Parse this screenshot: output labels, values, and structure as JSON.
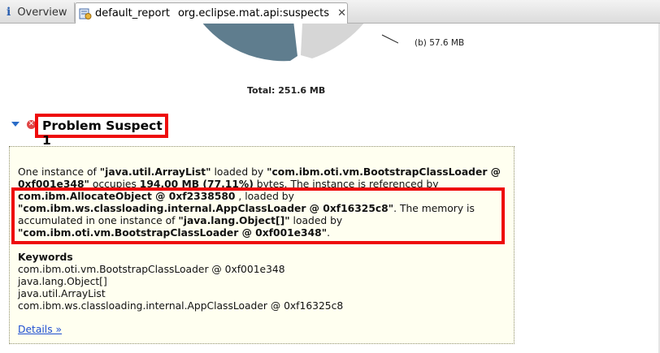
{
  "tabs": {
    "overview_label": "Overview",
    "active_name": "default_report",
    "active_query": "org.eclipse.mat.api:suspects"
  },
  "chart_data": {
    "type": "pie",
    "total_label": "Total: 251.6 MB",
    "slices": [
      {
        "label": "",
        "value": 194.0,
        "color": "#5f7d8e"
      },
      {
        "label": "(b)  57.6 MB",
        "value": 57.6,
        "color": "#d6d6d6"
      }
    ]
  },
  "suspect": {
    "title": "Problem Suspect 1",
    "desc": {
      "p1": "One instance of ",
      "class1": "\"java.util.ArrayList\"",
      "p2": " loaded by ",
      "loader1": "\"com.ibm.oti.vm.BootstrapClassLoader @ 0xf001e348\"",
      "p3": " occupies ",
      "size": "194.00 MB (77.11%)",
      "p4": " bytes. The instance is referenced by ",
      "ref": "com.ibm.AllocateObject @ 0xf2338580",
      "p5": " , loaded by ",
      "loader2": "\"com.ibm.ws.classloading.internal.AppClassLoader @ 0xf16325c8\"",
      "p6": ". The memory is accumulated in one instance of ",
      "class2": "\"java.lang.Object[]\"",
      "p7": " loaded by ",
      "loader3": "\"com.ibm.oti.vm.BootstrapClassLoader @ 0xf001e348\"",
      "p8": "."
    },
    "keywords_heading": "Keywords",
    "keywords": [
      "com.ibm.oti.vm.BootstrapClassLoader @ 0xf001e348",
      "java.lang.Object[]",
      "java.util.ArrayList",
      "com.ibm.ws.classloading.internal.AppClassLoader @ 0xf16325c8"
    ],
    "details_link": "Details »"
  }
}
